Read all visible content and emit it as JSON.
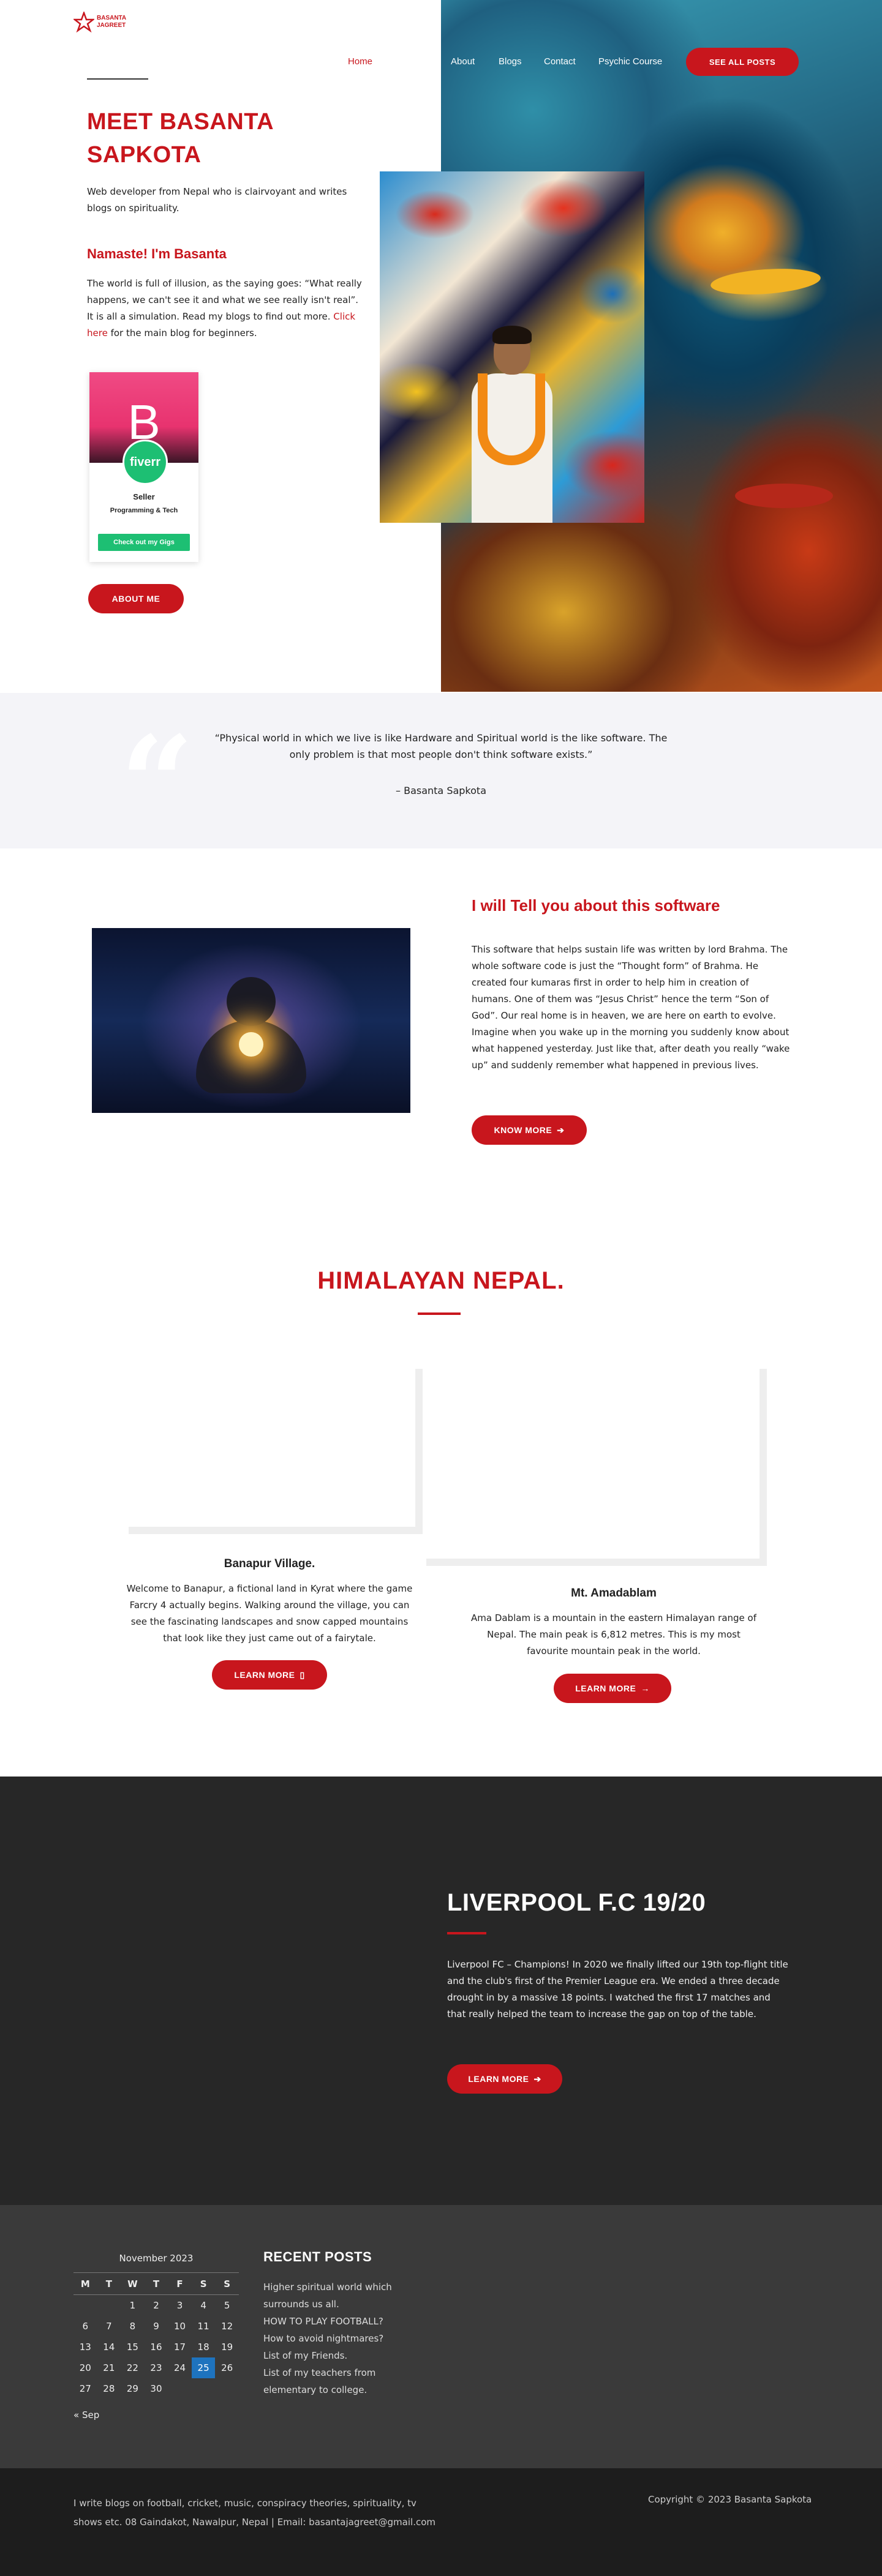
{
  "brand": {
    "line1": "BASANTA",
    "line2": "JAGREET"
  },
  "nav": {
    "home": "Home",
    "about": "About",
    "blogs": "Blogs",
    "contact": "Contact",
    "psychic": "Psychic Course",
    "see_all": "SEE ALL POSTS"
  },
  "hero": {
    "title": "MEET BASANTA SAPKOTA",
    "desc": "Web developer from Nepal who is clairvoyant and writes blogs on spirituality.",
    "subtitle": "Namaste! I'm Basanta",
    "para_before": "The world is full of illusion, as the saying goes: “What really happens, we can't see it and what we see really isn't real”. It is all a simulation. Read my blogs to find out more. ",
    "para_link": "Click here",
    "para_after": " for the main blog for beginners.",
    "about_btn": "ABOUT ME"
  },
  "fiverr": {
    "initial": "B",
    "logo": "fiverr",
    "level": "Seller",
    "category": "Programming & Tech",
    "cta": "Check out my Gigs"
  },
  "quote": {
    "mark": "“",
    "text": "“Physical world in which we live is like Hardware and Spiritual world is the like software. The only problem is that most people don't think software exists.”",
    "author": "– Basanta Sapkota"
  },
  "software": {
    "title": "I will Tell you about this software",
    "text": "This software that helps sustain life was written by lord Brahma. The whole software code is just the “Thought form” of Brahma. He created four kumaras first in order to help him in creation of humans. One of them was “Jesus Christ” hence the term “Son of God”. Our real home is in heaven, we are here on earth to evolve. Imagine when you wake up in the morning you suddenly know about what happened yesterday. Just like that, after death you really “wake up” and suddenly remember what happened in previous lives.",
    "btn": "KNOW MORE",
    "btn_icon": "arrow-right-icon"
  },
  "himalayan": {
    "title": "HIMALAYAN NEPAL.",
    "cards": [
      {
        "title": "Banapur Village.",
        "text": "Welcome to Banapur, a fictional land in Kyrat where the game Farcry 4 actually begins. Walking around the village, you can see the fascinating landscapes and snow capped mountains that look like they just came out of a fairytale.",
        "btn": "LEARN MORE",
        "icon": "▯"
      },
      {
        "title": "Mt. Amadablam",
        "text": "Ama Dablam is a mountain in the eastern Himalayan range of Nepal. The main peak is 6,812 metres. This is my most favourite mountain peak in the world.",
        "btn": "LEARN MORE",
        "icon": "→"
      }
    ]
  },
  "liverpool": {
    "title": "LIVERPOOL F.C 19/20",
    "text": "Liverpool FC – Champions! In 2020 we finally lifted our 19th top-flight title and the club's first of the Premier League era. We ended a three decade drought in by a massive 18 points. I watched the first 17 matches and that really helped the team to increase the gap on top of the table.",
    "btn": "LEARN MORE"
  },
  "calendar": {
    "title": "November 2023",
    "days": [
      "M",
      "T",
      "W",
      "T",
      "F",
      "S",
      "S"
    ],
    "weeks": [
      [
        "",
        "",
        "1",
        "2",
        "3",
        "4",
        "5"
      ],
      [
        "6",
        "7",
        "8",
        "9",
        "10",
        "11",
        "12"
      ],
      [
        "13",
        "14",
        "15",
        "16",
        "17",
        "18",
        "19"
      ],
      [
        "20",
        "21",
        "22",
        "23",
        "24",
        "25",
        "26"
      ],
      [
        "27",
        "28",
        "29",
        "30",
        "",
        "",
        ""
      ]
    ],
    "today": "25",
    "prev": "« Sep"
  },
  "recent": {
    "title": "RECENT POSTS",
    "items": [
      "Higher spiritual world which surrounds us all.",
      "HOW TO PLAY FOOTBALL?",
      "How to avoid nightmares?",
      "List of my Friends.",
      "List of my teachers from elementary to college."
    ]
  },
  "footer": {
    "text": "I write blogs on football, cricket, music, conspiracy theories, spirituality, tv shows etc. 08 Gaindakot, Nawalpur, Nepal | Email: basantajagreet@gmail.com",
    "copyright": "Copyright © 2023 Basanta Sapkota"
  },
  "colors": {
    "accent": "#c8161d",
    "dark": "#272727",
    "widgets": "#3a3a3a",
    "footer": "#1d1d1d",
    "fiverr": "#1dbf73",
    "today": "#1e73be"
  }
}
